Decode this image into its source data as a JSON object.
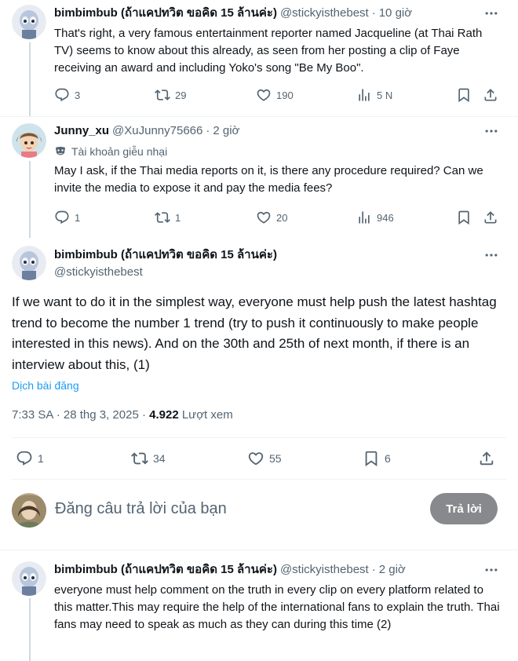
{
  "tweets": [
    {
      "name": "bimbimbub (ถ้าแคปทวิต ขอคิด 15 ล้านค่ะ)",
      "handle": "@stickyisthebest",
      "sep": "·",
      "time": "10 giờ",
      "text": "That's right, a very famous entertainment reporter named Jacqueline (at Thai Rath TV) seems to know about this already, as seen from her posting a clip of Faye receiving an award and including Yoko's song \"Be My Boo\".",
      "replies": "3",
      "reposts": "29",
      "likes": "190",
      "views": "5 N"
    },
    {
      "name": "Junny_xu",
      "handle": "@XuJunny75666",
      "sep": "·",
      "time": "2 giờ",
      "badge": "Tài khoản giễu nhại",
      "text": "May I ask, if the Thai media reports on it, is there any procedure required? Can we invite the media to expose it and pay the media fees?",
      "replies": "1",
      "reposts": "1",
      "likes": "20",
      "views": "946"
    }
  ],
  "main_tweet": {
    "name": "bimbimbub (ถ้าแคปทวิต ขอคิด 15 ล้านค่ะ)",
    "handle": "@stickyisthebest",
    "text": "If we want to do it in the simplest way, everyone must help push the latest hashtag trend to become the number 1 trend (try to push it continuously to make people interested in this news). And on the 30th and 25th of next month, if there is an interview about this, (1)",
    "translate": "Dịch bài đăng",
    "time": "7:33 SA · 28 thg 3, 2025 · ",
    "views_count": "4.922",
    "views_label": " Lượt xem",
    "replies": "1",
    "reposts": "34",
    "likes": "55",
    "bookmarks": "6"
  },
  "reply_box": {
    "placeholder": "Đăng câu trả lời của bạn",
    "button": "Trả lời"
  },
  "last_tweet": {
    "name": "bimbimbub (ถ้าแคปทวิต ขอคิด 15 ล้านค่ะ)",
    "handle": "@stickyisthebest",
    "sep": "·",
    "time": "2 giờ",
    "text": "everyone must help comment on the truth in every clip on every platform related to this matter.This may require the help of the international fans to explain the truth. Thai fans may need to speak as much as they can during this time (2)"
  },
  "icons": {
    "reply": "reply-icon",
    "repost": "repost-icon",
    "like": "heart-icon",
    "views": "views-icon",
    "bookmark": "bookmark-icon",
    "share": "share-icon",
    "more": "more-icon"
  },
  "colors": {
    "text": "#0f1419",
    "secondary": "#536471",
    "link": "#1d9bf0",
    "line": "#cfd9de",
    "button_bg": "#87898c"
  }
}
